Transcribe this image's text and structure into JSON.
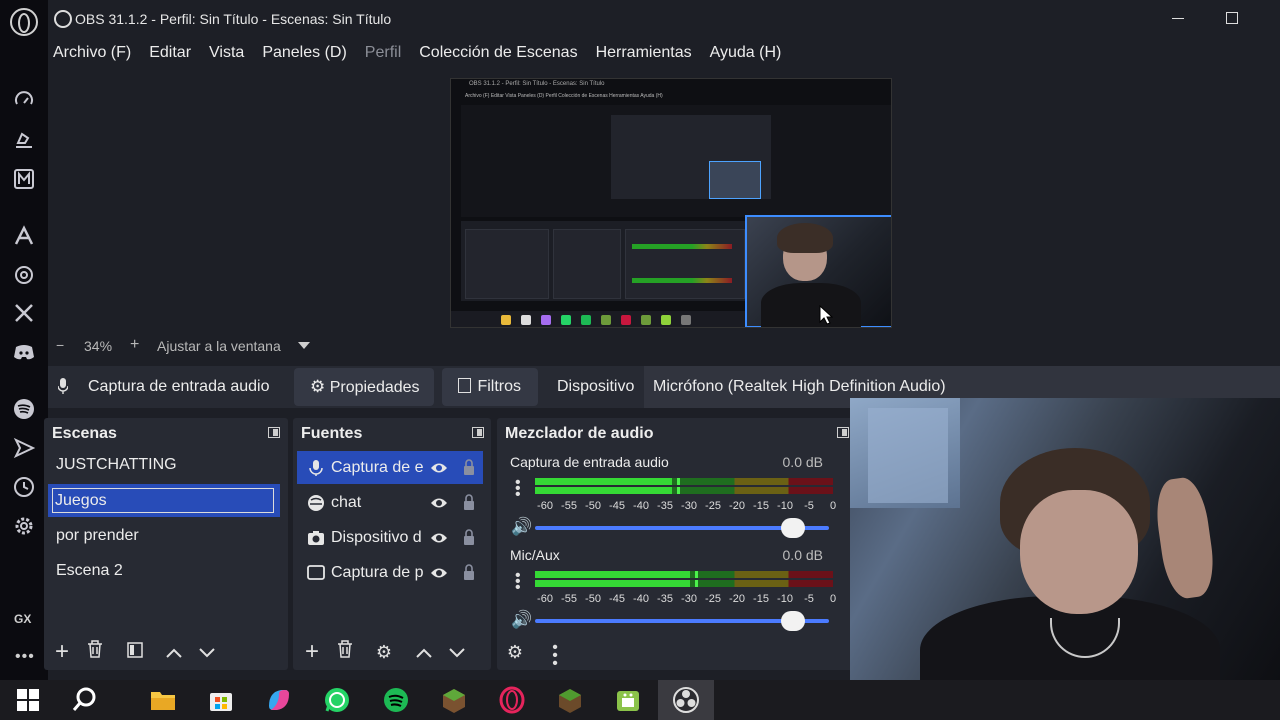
{
  "window": {
    "title": "OBS 31.1.2 - Perfil: Sin Título - Escenas: Sin Título"
  },
  "menu": [
    "Archivo (F)",
    "Editar",
    "Vista",
    "Paneles (D)",
    "Perfil",
    "Colección de Escenas",
    "Herramientas",
    "Ayuda (H)"
  ],
  "browser_sidebar": {
    "label": "GX",
    "icons": [
      "opera-gx-logo",
      "speed-dial-icon",
      "flow-icon",
      "mail-icon",
      "aria-icon",
      "chatgpt-icon",
      "x-twitter-icon",
      "discord-icon",
      "spotify-icon",
      "send-icon",
      "history-icon",
      "settings-icon",
      "more-icon"
    ]
  },
  "preview": {
    "zoom": "34%",
    "fit_label": "Ajustar a la ventana",
    "nested_title": "OBS 31.1.2 - Perfil: Sin Título - Escenas: Sin Título",
    "nested_menu": "Archivo (F)   Editar   Vista   Paneles (D)   Perfil   Colección de Escenas   Herramientas   Ayuda (H)"
  },
  "context": {
    "source": "Captura de entrada audio",
    "properties": "Propiedades",
    "filters": "Filtros",
    "device_label": "Dispositivo",
    "device": "Micrófono (Realtek High Definition Audio)"
  },
  "scenes": {
    "title": "Escenas",
    "items": [
      "JUSTCHATTING",
      "Juegos",
      "por prender",
      "Escena 2"
    ],
    "selected": 1
  },
  "sources": {
    "title": "Fuentes",
    "items": [
      {
        "name": "Captura de e",
        "icon": "microphone-icon"
      },
      {
        "name": "chat",
        "icon": "browser-icon"
      },
      {
        "name": "Dispositivo d",
        "icon": "camera-icon"
      },
      {
        "name": "Captura de p",
        "icon": "monitor-icon"
      }
    ]
  },
  "mixer": {
    "title": "Mezclador de audio",
    "scale": [
      "-60",
      "-55",
      "-50",
      "-45",
      "-40",
      "-35",
      "-30",
      "-25",
      "-20",
      "-15",
      "-10",
      "-5",
      "0"
    ],
    "channels": [
      {
        "name": "Captura de entrada audio",
        "db": "0.0 dB",
        "level": 0.46,
        "peak": 0.47,
        "volume": 1.0
      },
      {
        "name": "Mic/Aux",
        "db": "0.0 dB",
        "level": 0.52,
        "peak": 0.53,
        "volume": 1.0
      }
    ]
  },
  "taskbar": {
    "icons": [
      "windows-start-icon",
      "search-icon",
      "file-explorer-icon",
      "microsoft-store-icon",
      "copilot-icon",
      "whatsapp-icon",
      "spotify-icon",
      "minecraft-icon",
      "opera-gx-icon",
      "minecraft-launcher-icon",
      "android-icon",
      "obs-icon"
    ]
  },
  "colors": {
    "background": "#1d1f26",
    "panel": "#272a33",
    "selection": "#284cb8",
    "meter_green": "#35d935",
    "meter_yellow": "#6b6114",
    "meter_red": "#6b1119"
  }
}
